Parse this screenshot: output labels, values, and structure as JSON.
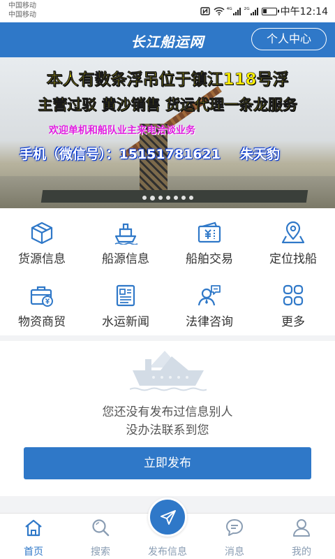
{
  "status_bar": {
    "carrier_1": "中国移动",
    "carrier_2": "中国移动",
    "signal_1": "⁴ᴳ",
    "signal_2": "²ᴳ",
    "time": "中午12:14"
  },
  "header": {
    "title": "长江船运网",
    "profile_button": "个人中心"
  },
  "banner": {
    "line1": "本人有数条浮吊位于镇江118号浮",
    "line2": "主营过驳 黄沙销售 货运代理一条龙服务",
    "line3": "欢迎单机和船队业主来电洽谈业务",
    "phone": "手机（微信号）：15151781621",
    "name": "朱天豹",
    "slide_count": 7,
    "active_slide": 1
  },
  "menu": [
    {
      "label": "货源信息",
      "icon": "cargo-box-icon"
    },
    {
      "label": "船源信息",
      "icon": "ship-icon"
    },
    {
      "label": "船舶交易",
      "icon": "ticket-icon"
    },
    {
      "label": "定位找船",
      "icon": "map-pin-icon"
    },
    {
      "label": "物资商贸",
      "icon": "briefcase-yen-icon"
    },
    {
      "label": "水运新闻",
      "icon": "newspaper-icon"
    },
    {
      "label": "法律咨询",
      "icon": "consultant-icon"
    },
    {
      "label": "更多",
      "icon": "grid-more-icon"
    }
  ],
  "empty_state": {
    "line1": "您还没有发布过信息别人",
    "line2": "没办法联系到您",
    "button": "立即发布"
  },
  "bottom_nav": [
    {
      "label": "首页",
      "icon": "home-icon",
      "active": true
    },
    {
      "label": "搜索",
      "icon": "search-icon",
      "active": false
    },
    {
      "label": "发布信息",
      "icon": "send-icon",
      "active": false
    },
    {
      "label": "消息",
      "icon": "message-icon",
      "active": false
    },
    {
      "label": "我的",
      "icon": "user-icon",
      "active": false
    }
  ],
  "colors": {
    "primary": "#2f78c8",
    "nav_inactive": "#8a9db3",
    "banner_yellow": "#fff200",
    "banner_magenta": "#e020e0"
  }
}
